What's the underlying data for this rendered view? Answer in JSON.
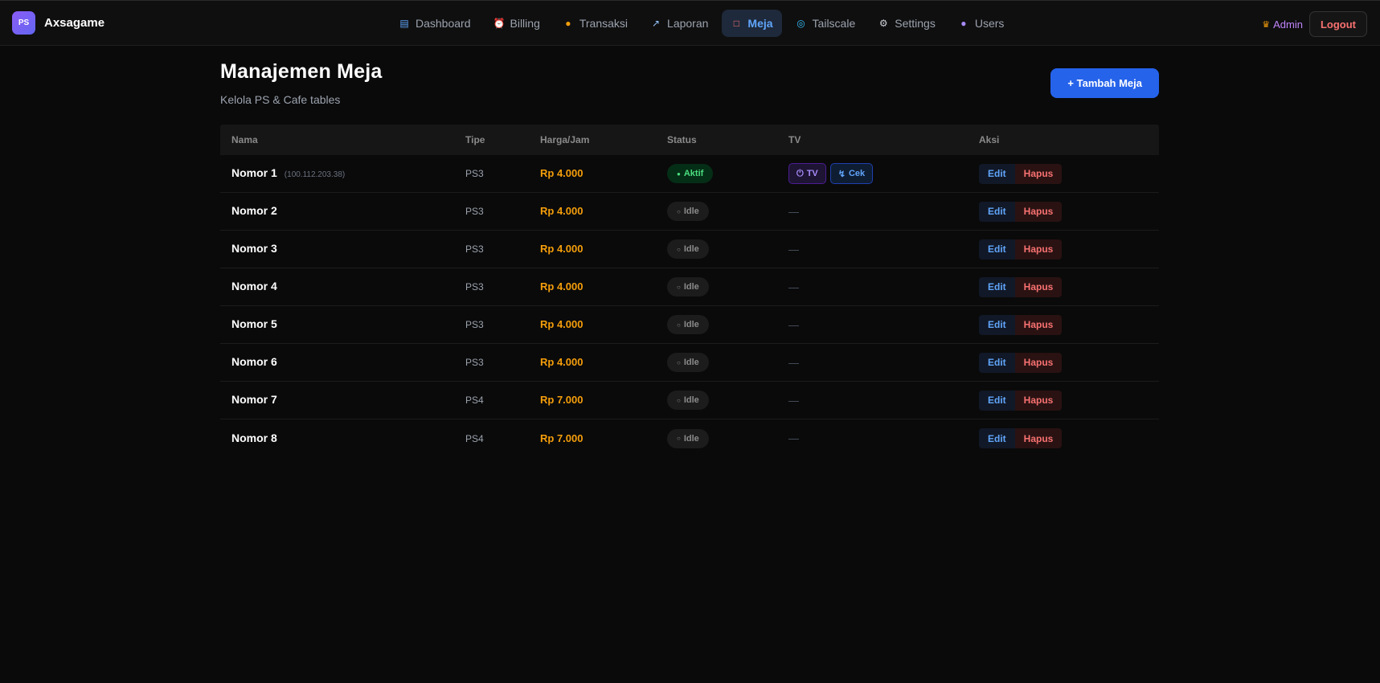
{
  "brand": {
    "logo_text": "PS",
    "name": "Axsagame"
  },
  "nav": [
    {
      "label": "Dashboard",
      "icon": "chart-icon"
    },
    {
      "label": "Billing",
      "icon": "clock-icon"
    },
    {
      "label": "Transaksi",
      "icon": "money-bag-icon"
    },
    {
      "label": "Laporan",
      "icon": "trend-icon"
    },
    {
      "label": "Meja",
      "icon": "chair-icon",
      "active": true
    },
    {
      "label": "Tailscale",
      "icon": "globe-icon"
    },
    {
      "label": "Settings",
      "icon": "gear-icon"
    },
    {
      "label": "Users",
      "icon": "users-icon"
    }
  ],
  "user": {
    "name": "Admin",
    "logout": "Logout"
  },
  "page": {
    "title": "Manajemen Meja",
    "subtitle": "Kelola PS & Cafe tables",
    "add_button": "+ Tambah Meja"
  },
  "table": {
    "headers": [
      "Nama",
      "Tipe",
      "Harga/Jam",
      "Status",
      "TV",
      "Aksi"
    ],
    "tv_power_label": "TV",
    "tv_check_label": "Cek",
    "edit_label": "Edit",
    "delete_label": "Hapus",
    "rows": [
      {
        "name": "Nomor 1",
        "ip": "(100.112.203.38)",
        "type": "PS3",
        "price": "Rp 4.000",
        "status": "Aktif",
        "tv": "controls"
      },
      {
        "name": "Nomor 2",
        "ip": "",
        "type": "PS3",
        "price": "Rp 4.000",
        "status": "Idle",
        "tv": "—"
      },
      {
        "name": "Nomor 3",
        "ip": "",
        "type": "PS3",
        "price": "Rp 4.000",
        "status": "Idle",
        "tv": "—"
      },
      {
        "name": "Nomor 4",
        "ip": "",
        "type": "PS3",
        "price": "Rp 4.000",
        "status": "Idle",
        "tv": "—"
      },
      {
        "name": "Nomor 5",
        "ip": "",
        "type": "PS3",
        "price": "Rp 4.000",
        "status": "Idle",
        "tv": "—"
      },
      {
        "name": "Nomor 6",
        "ip": "",
        "type": "PS3",
        "price": "Rp 4.000",
        "status": "Idle",
        "tv": "—"
      },
      {
        "name": "Nomor 7",
        "ip": "",
        "type": "PS4",
        "price": "Rp 7.000",
        "status": "Idle",
        "tv": "—"
      },
      {
        "name": "Nomor 8",
        "ip": "",
        "type": "PS4",
        "price": "Rp 7.000",
        "status": "Idle",
        "tv": "—"
      }
    ]
  },
  "colors": {
    "accent": "#2563eb",
    "price": "#f59e0b",
    "active_status": "#4ade80",
    "danger": "#f87171"
  }
}
